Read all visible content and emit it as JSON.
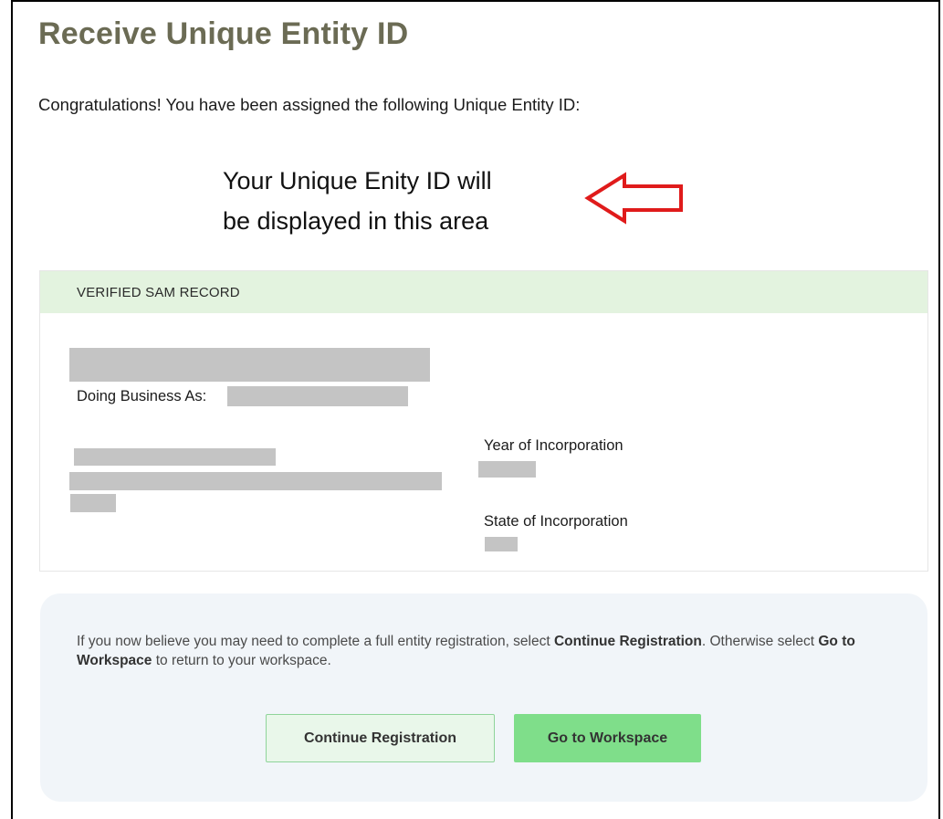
{
  "page": {
    "title": "Receive Unique Entity ID",
    "congrats_text": "Congratulations! You have been assigned the following Unique Entity ID:",
    "id_placeholder_note_line1": "Your Unique Enity ID will",
    "id_placeholder_note_line2": "be displayed in this area"
  },
  "record": {
    "header": "VERIFIED SAM RECORD",
    "dba_label": "Doing Business As:",
    "year_label": "Year of Incorporation",
    "state_label": "State of Incorporation"
  },
  "cta": {
    "text_before": "If you now believe you may need to complete a full entity registration, select ",
    "text_bold1": "Continue Registration",
    "text_mid": ". Otherwise select ",
    "text_bold2": "Go to Workspace",
    "text_after": " to return to your workspace.",
    "continue_label": "Continue Registration",
    "workspace_label": "Go to Workspace"
  },
  "colors": {
    "title": "#6b6b54",
    "record_header_bg": "#e3f3df",
    "arrow": "#e01b1b",
    "cta_bg": "#f1f5f9",
    "workspace_btn": "#7fde8a",
    "continue_btn_border": "#8fd49a"
  }
}
